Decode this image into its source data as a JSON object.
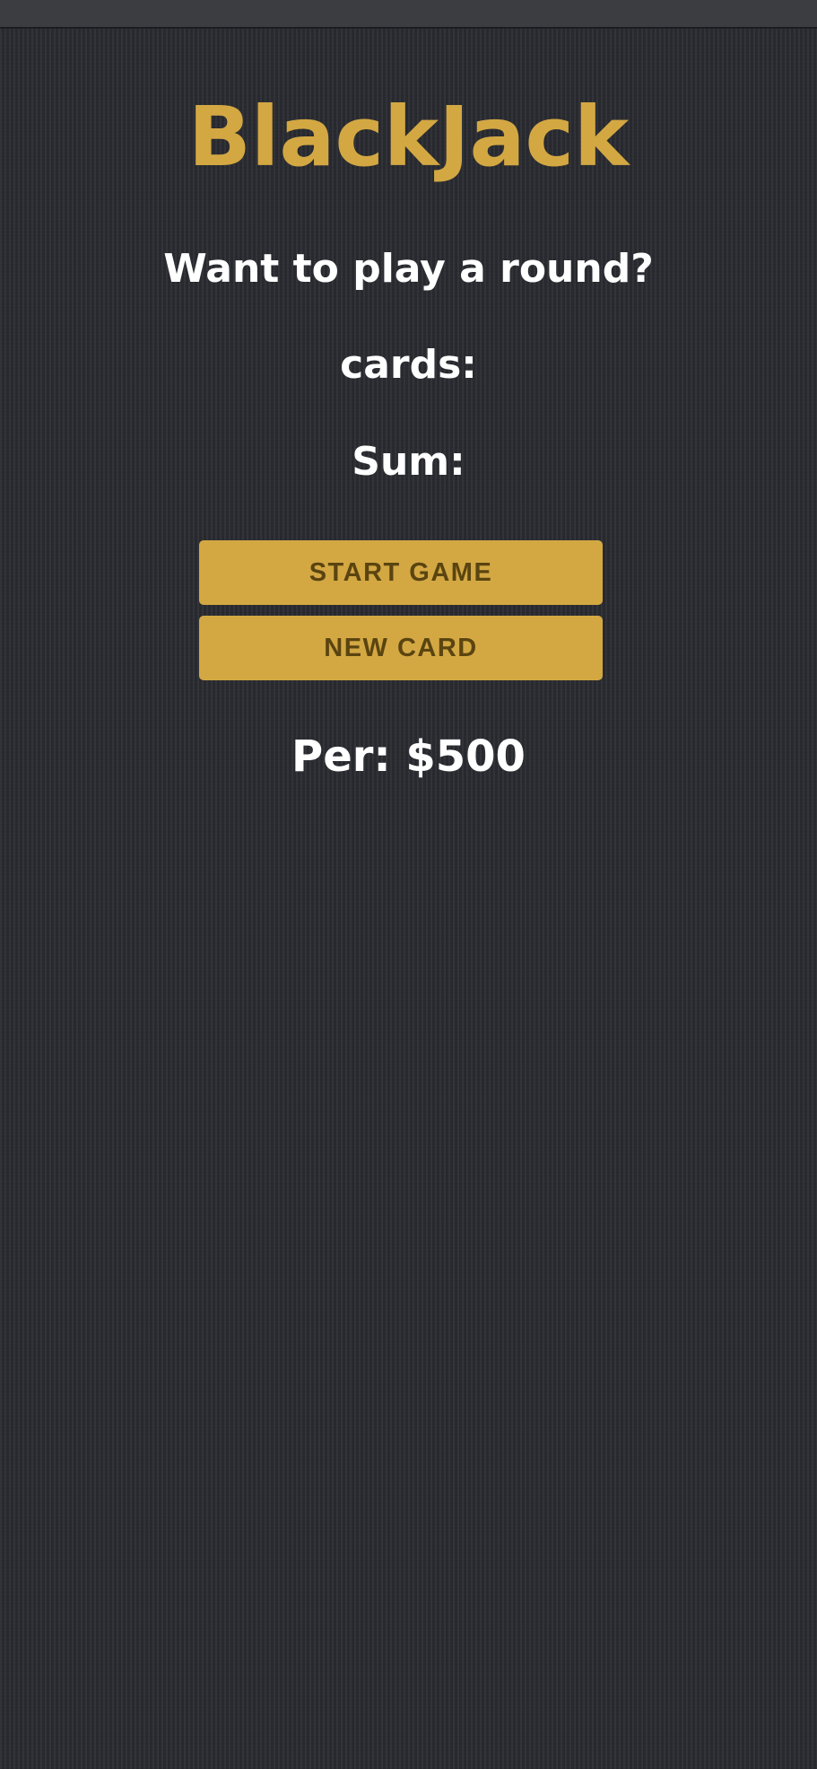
{
  "game": {
    "title": "BlackJack",
    "message": "Want to play a round?",
    "cards_label": "cards:",
    "sum_label": "Sum:",
    "start_button_label": "START GAME",
    "new_card_button_label": "NEW CARD",
    "player_info": "Per: $500"
  },
  "colors": {
    "accent": "#d3a843",
    "background": "#2b2d32",
    "button_text": "#5a4410",
    "text": "#ffffff"
  }
}
